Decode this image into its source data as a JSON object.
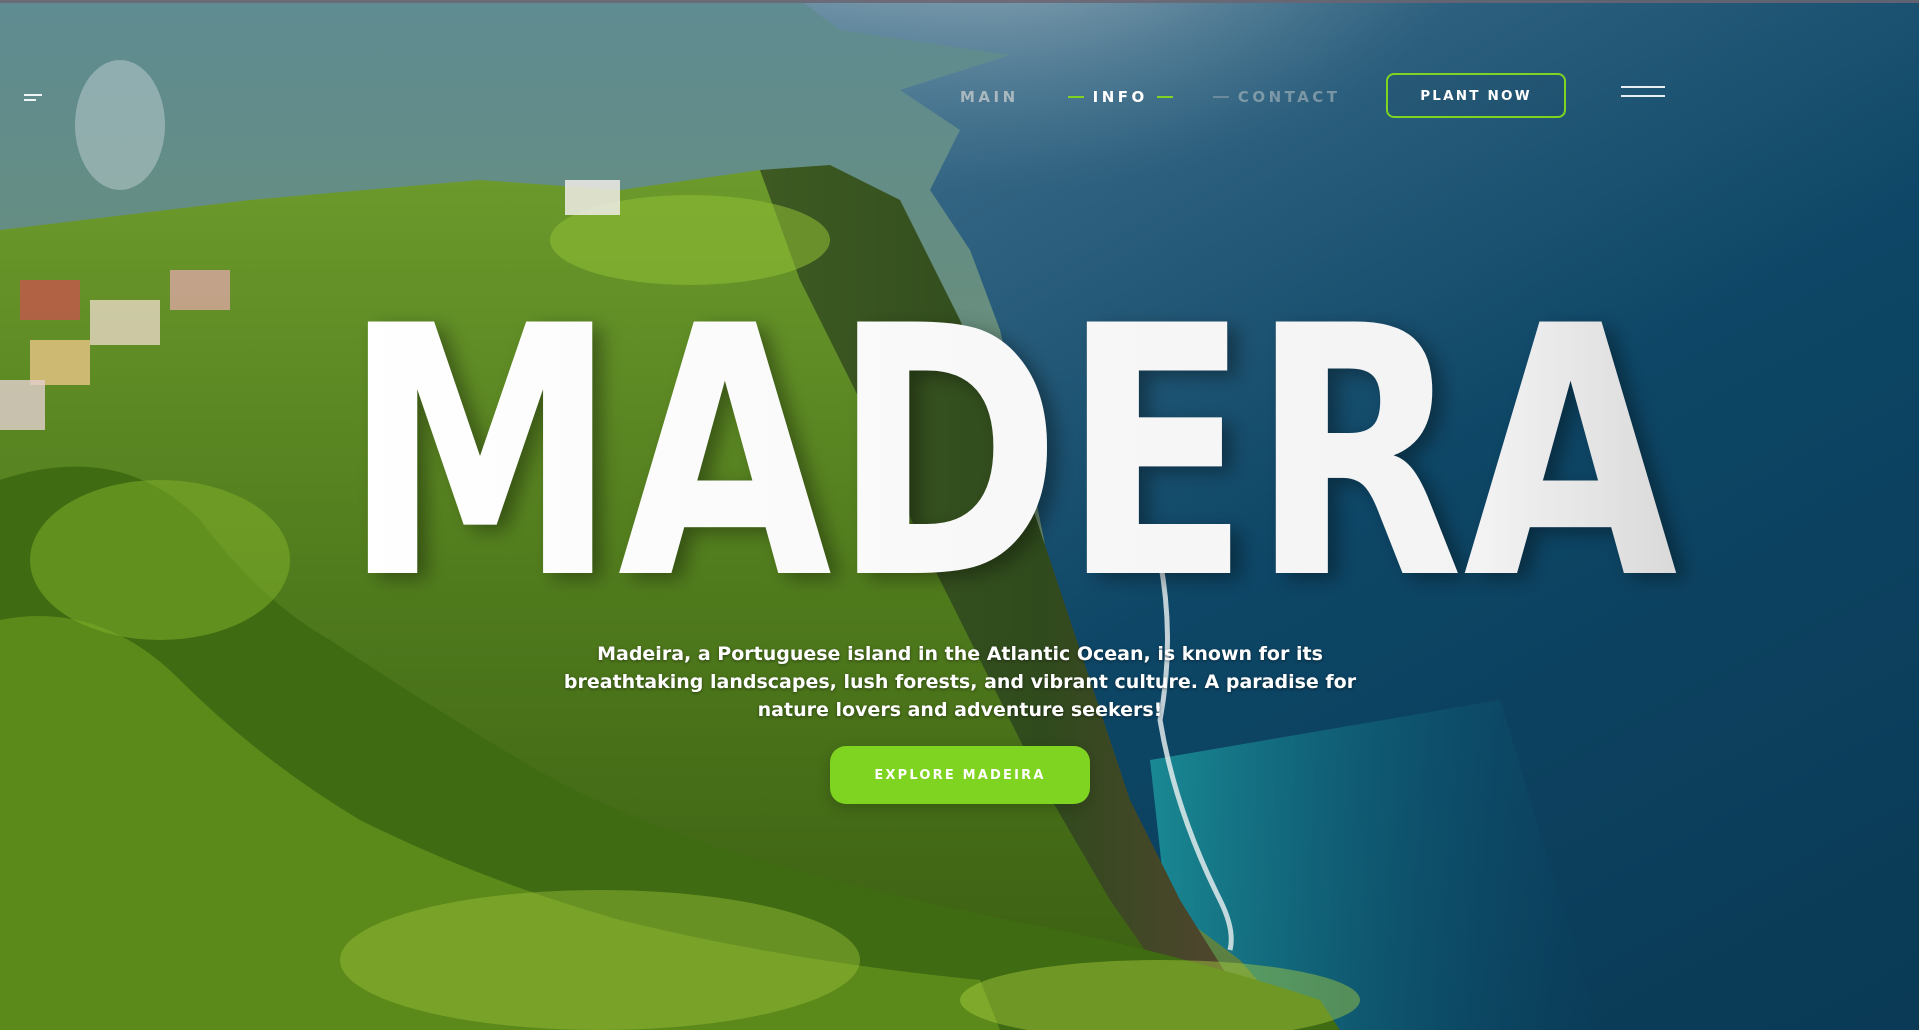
{
  "nav": {
    "items": [
      {
        "label": "MAIN"
      },
      {
        "label": "INFO"
      },
      {
        "label": "CONTACT"
      }
    ],
    "cta_label": "PLANT NOW"
  },
  "hero": {
    "title": "MADERA",
    "description": "Madeira, a Portuguese island in the Atlantic Ocean, is known for its breathtaking landscapes, lush forests, and vibrant culture. A paradise for nature lovers and adventure seekers!",
    "button_label": "EXPLORE MADEIRA"
  },
  "icons": {
    "logo": "logo-icon",
    "menu": "hamburger-menu-icon"
  },
  "colors": {
    "accent": "#7fd321",
    "text": "#ffffff",
    "ocean": "#0d4a6b"
  }
}
